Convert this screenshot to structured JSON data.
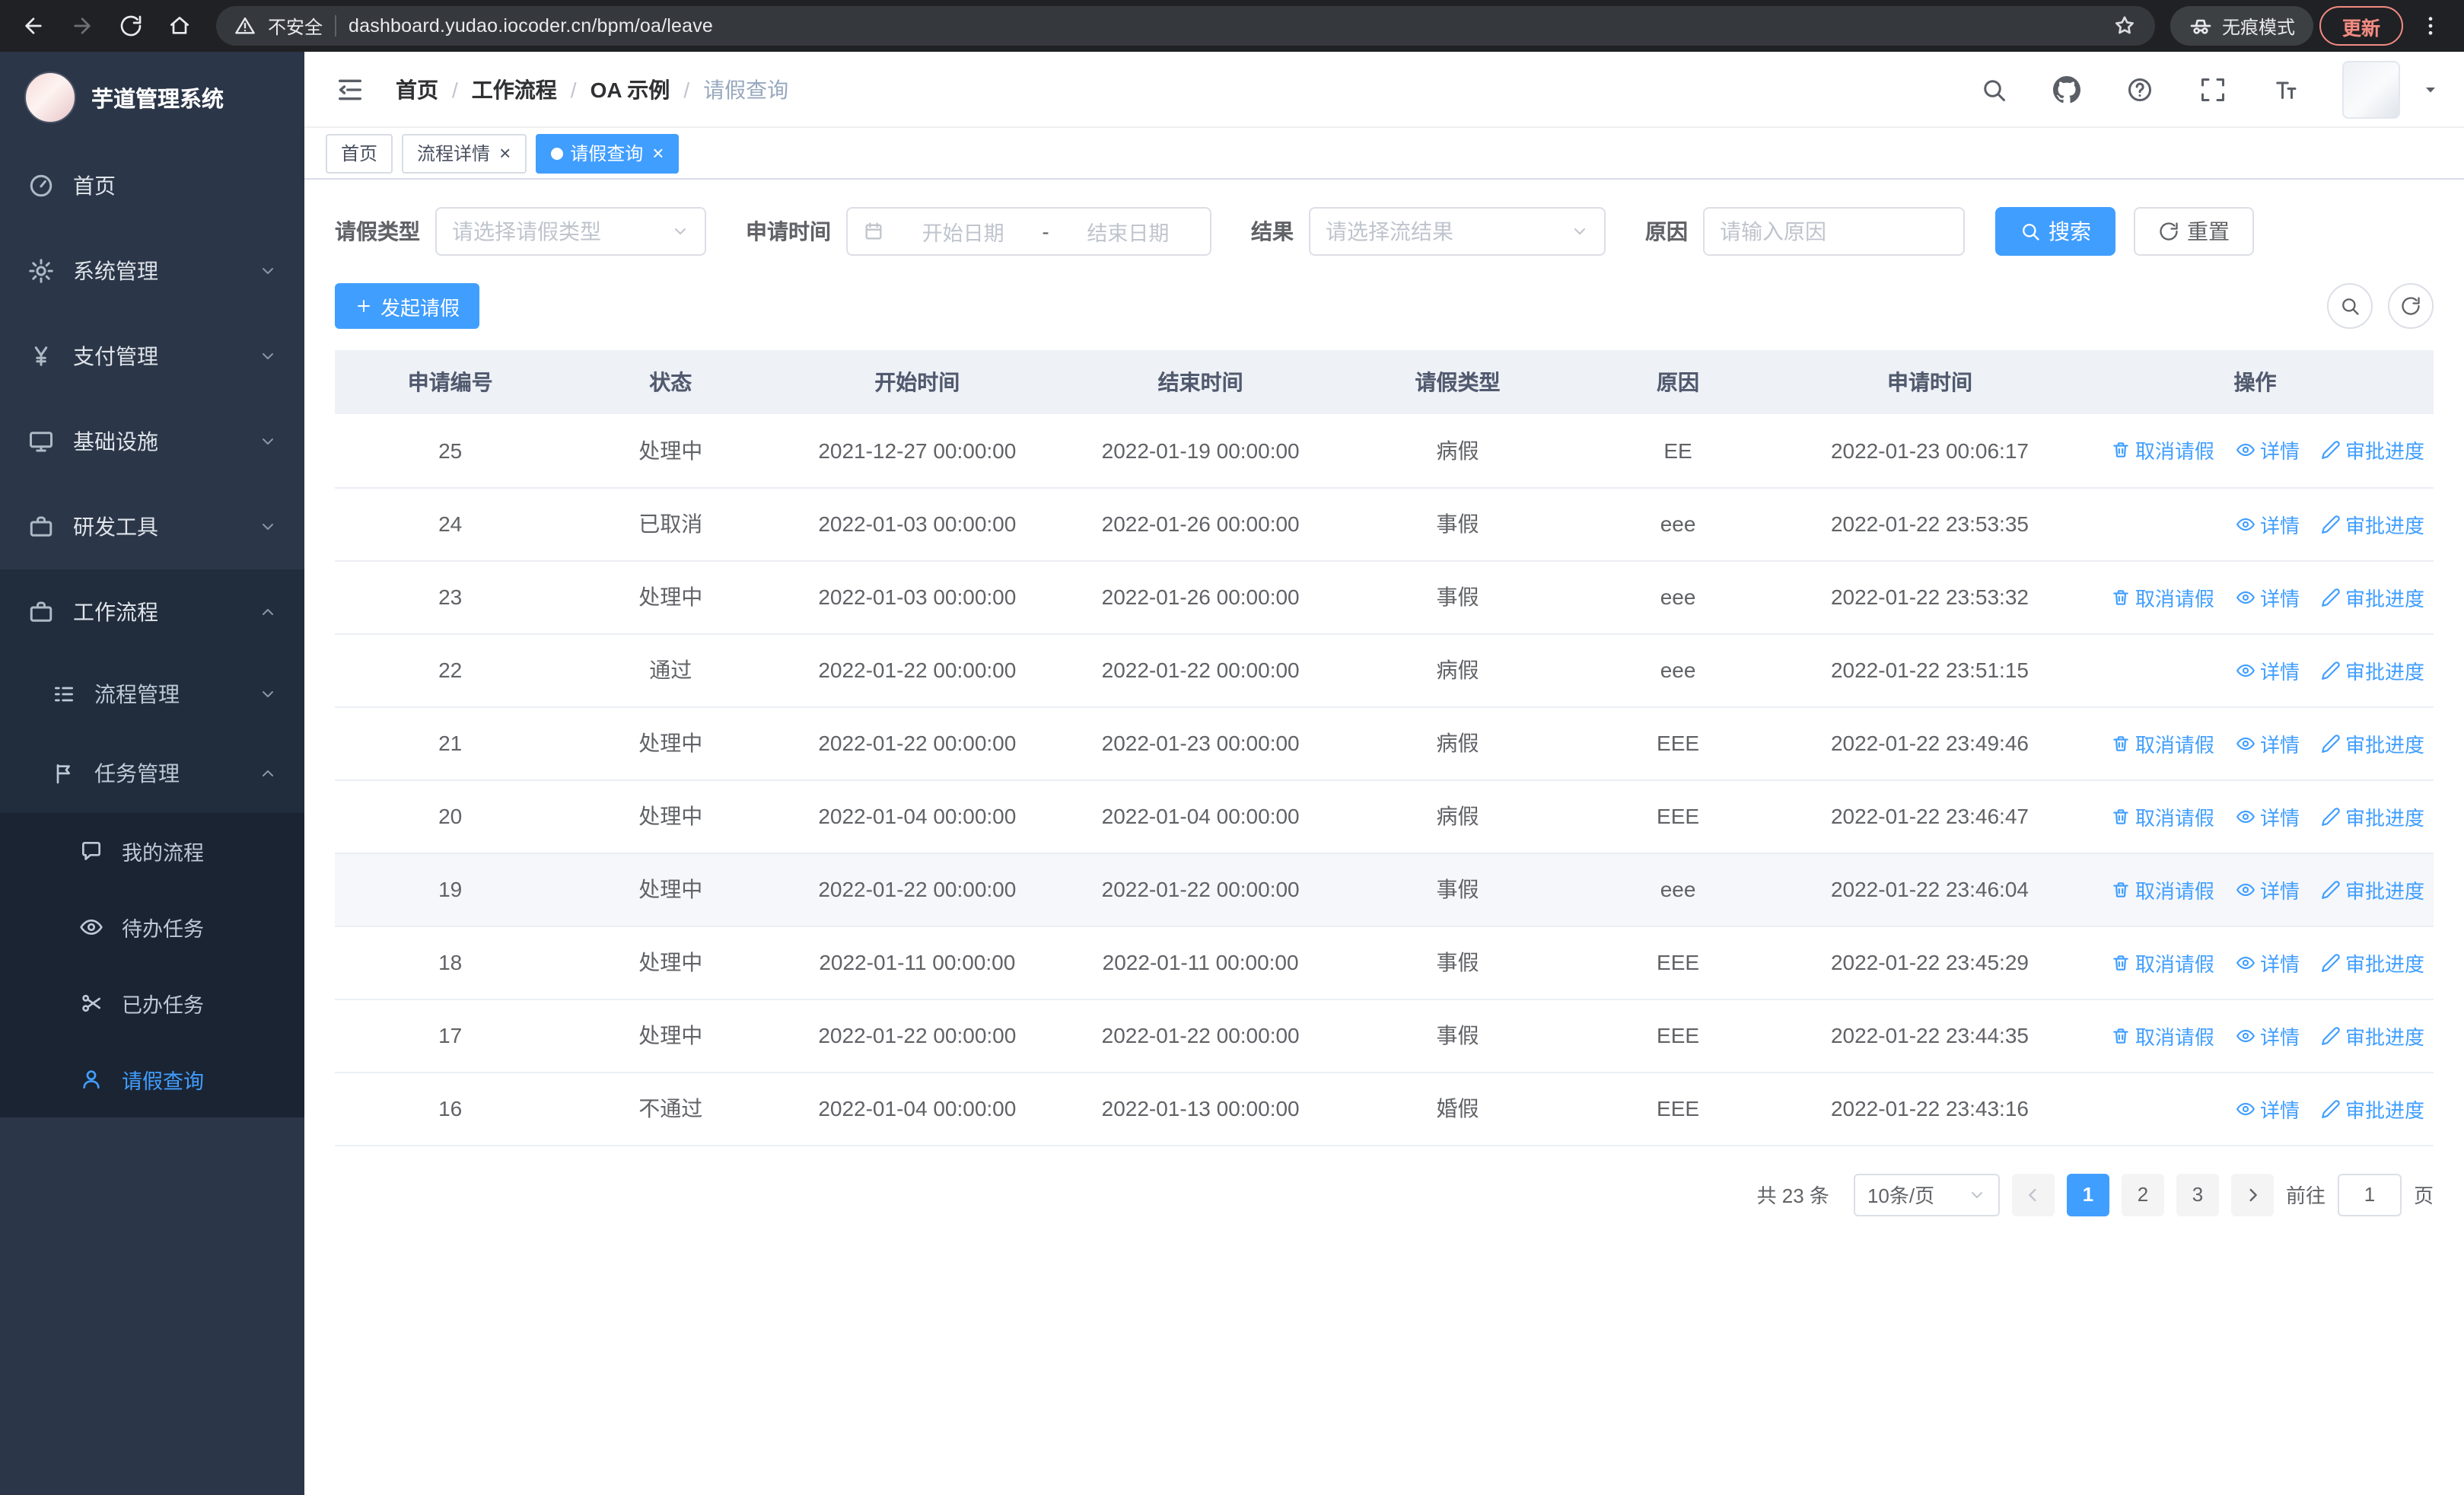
{
  "browser": {
    "security_label": "不安全",
    "url": "dashboard.yudao.iocoder.cn/bpm/oa/leave",
    "incognito_label": "无痕模式",
    "update_label": "更新"
  },
  "app": {
    "logo_title": "芋道管理系统",
    "breadcrumb": [
      "首页",
      "工作流程",
      "OA 示例",
      "请假查询"
    ]
  },
  "tabs": [
    {
      "label": "首页",
      "closable": false,
      "active": false
    },
    {
      "label": "流程详情",
      "closable": true,
      "active": false
    },
    {
      "label": "请假查询",
      "closable": true,
      "active": true
    }
  ],
  "sidebar": {
    "home": "首页",
    "system": "系统管理",
    "payment": "支付管理",
    "infra": "基础设施",
    "devtools": "研发工具",
    "workflow": "工作流程",
    "process_mgmt": "流程管理",
    "task_mgmt": "任务管理",
    "my_process": "我的流程",
    "todo_tasks": "待办任务",
    "done_tasks": "已办任务",
    "leave_query": "请假查询"
  },
  "filters": {
    "leave_type_label": "请假类型",
    "leave_type_placeholder": "请选择请假类型",
    "apply_time_label": "申请时间",
    "start_date_placeholder": "开始日期",
    "range_separator": "-",
    "end_date_placeholder": "结束日期",
    "result_label": "结果",
    "result_placeholder": "请选择流结果",
    "reason_label": "原因",
    "reason_placeholder": "请输入原因",
    "search_button": "搜索",
    "reset_button": "重置"
  },
  "toolbar": {
    "create_button": "发起请假"
  },
  "table": {
    "columns": [
      "申请编号",
      "状态",
      "开始时间",
      "结束时间",
      "请假类型",
      "原因",
      "申请时间",
      "操作"
    ],
    "rows": [
      {
        "id": "25",
        "status": "处理中",
        "start": "2021-12-27 00:00:00",
        "end": "2022-01-19 00:00:00",
        "type": "病假",
        "reason": "EE",
        "apply_time": "2022-01-23 00:06:17",
        "highlight": false,
        "actions": [
          {
            "label": "取消请假",
            "name": "cancel-leave-link",
            "icon": "trash-icon"
          },
          {
            "label": "详情",
            "name": "detail-link",
            "icon": "eye-icon"
          },
          {
            "label": "审批进度",
            "name": "approval-progress-link",
            "icon": "edit-icon"
          }
        ]
      },
      {
        "id": "24",
        "status": "已取消",
        "start": "2022-01-03 00:00:00",
        "end": "2022-01-26 00:00:00",
        "type": "事假",
        "reason": "eee",
        "apply_time": "2022-01-22 23:53:35",
        "highlight": false,
        "actions": [
          {
            "label": "详情",
            "name": "detail-link",
            "icon": "eye-icon"
          },
          {
            "label": "审批进度",
            "name": "approval-progress-link",
            "icon": "edit-icon"
          }
        ]
      },
      {
        "id": "23",
        "status": "处理中",
        "start": "2022-01-03 00:00:00",
        "end": "2022-01-26 00:00:00",
        "type": "事假",
        "reason": "eee",
        "apply_time": "2022-01-22 23:53:32",
        "highlight": false,
        "actions": [
          {
            "label": "取消请假",
            "name": "cancel-leave-link",
            "icon": "trash-icon"
          },
          {
            "label": "详情",
            "name": "detail-link",
            "icon": "eye-icon"
          },
          {
            "label": "审批进度",
            "name": "approval-progress-link",
            "icon": "edit-icon"
          }
        ]
      },
      {
        "id": "22",
        "status": "通过",
        "start": "2022-01-22 00:00:00",
        "end": "2022-01-22 00:00:00",
        "type": "病假",
        "reason": "eee",
        "apply_time": "2022-01-22 23:51:15",
        "highlight": false,
        "actions": [
          {
            "label": "详情",
            "name": "detail-link",
            "icon": "eye-icon"
          },
          {
            "label": "审批进度",
            "name": "approval-progress-link",
            "icon": "edit-icon"
          }
        ]
      },
      {
        "id": "21",
        "status": "处理中",
        "start": "2022-01-22 00:00:00",
        "end": "2022-01-23 00:00:00",
        "type": "病假",
        "reason": "EEE",
        "apply_time": "2022-01-22 23:49:46",
        "highlight": false,
        "actions": [
          {
            "label": "取消请假",
            "name": "cancel-leave-link",
            "icon": "trash-icon"
          },
          {
            "label": "详情",
            "name": "detail-link",
            "icon": "eye-icon"
          },
          {
            "label": "审批进度",
            "name": "approval-progress-link",
            "icon": "edit-icon"
          }
        ]
      },
      {
        "id": "20",
        "status": "处理中",
        "start": "2022-01-04 00:00:00",
        "end": "2022-01-04 00:00:00",
        "type": "病假",
        "reason": "EEE",
        "apply_time": "2022-01-22 23:46:47",
        "highlight": false,
        "actions": [
          {
            "label": "取消请假",
            "name": "cancel-leave-link",
            "icon": "trash-icon"
          },
          {
            "label": "详情",
            "name": "detail-link",
            "icon": "eye-icon"
          },
          {
            "label": "审批进度",
            "name": "approval-progress-link",
            "icon": "edit-icon"
          }
        ]
      },
      {
        "id": "19",
        "status": "处理中",
        "start": "2022-01-22 00:00:00",
        "end": "2022-01-22 00:00:00",
        "type": "事假",
        "reason": "eee",
        "apply_time": "2022-01-22 23:46:04",
        "highlight": true,
        "actions": [
          {
            "label": "取消请假",
            "name": "cancel-leave-link",
            "icon": "trash-icon"
          },
          {
            "label": "详情",
            "name": "detail-link",
            "icon": "eye-icon"
          },
          {
            "label": "审批进度",
            "name": "approval-progress-link",
            "icon": "edit-icon"
          }
        ]
      },
      {
        "id": "18",
        "status": "处理中",
        "start": "2022-01-11 00:00:00",
        "end": "2022-01-11 00:00:00",
        "type": "事假",
        "reason": "EEE",
        "apply_time": "2022-01-22 23:45:29",
        "highlight": false,
        "actions": [
          {
            "label": "取消请假",
            "name": "cancel-leave-link",
            "icon": "trash-icon"
          },
          {
            "label": "详情",
            "name": "detail-link",
            "icon": "eye-icon"
          },
          {
            "label": "审批进度",
            "name": "approval-progress-link",
            "icon": "edit-icon"
          }
        ]
      },
      {
        "id": "17",
        "status": "处理中",
        "start": "2022-01-22 00:00:00",
        "end": "2022-01-22 00:00:00",
        "type": "事假",
        "reason": "EEE",
        "apply_time": "2022-01-22 23:44:35",
        "highlight": false,
        "actions": [
          {
            "label": "取消请假",
            "name": "cancel-leave-link",
            "icon": "trash-icon"
          },
          {
            "label": "详情",
            "name": "detail-link",
            "icon": "eye-icon"
          },
          {
            "label": "审批进度",
            "name": "approval-progress-link",
            "icon": "edit-icon"
          }
        ]
      },
      {
        "id": "16",
        "status": "不通过",
        "start": "2022-01-04 00:00:00",
        "end": "2022-01-13 00:00:00",
        "type": "婚假",
        "reason": "EEE",
        "apply_time": "2022-01-22 23:43:16",
        "highlight": false,
        "actions": [
          {
            "label": "详情",
            "name": "detail-link",
            "icon": "eye-icon"
          },
          {
            "label": "审批进度",
            "name": "approval-progress-link",
            "icon": "edit-icon"
          }
        ]
      }
    ]
  },
  "pagination": {
    "total": "共 23 条",
    "page_size": "10条/页",
    "pages": [
      "1",
      "2",
      "3"
    ],
    "active_page": "1",
    "goto_label": "前往",
    "goto_value": "1",
    "goto_suffix": "页"
  },
  "colors": {
    "accent": "#409eff",
    "sidebar_bg": "#2b3648",
    "update_chip": "#f28b82"
  }
}
